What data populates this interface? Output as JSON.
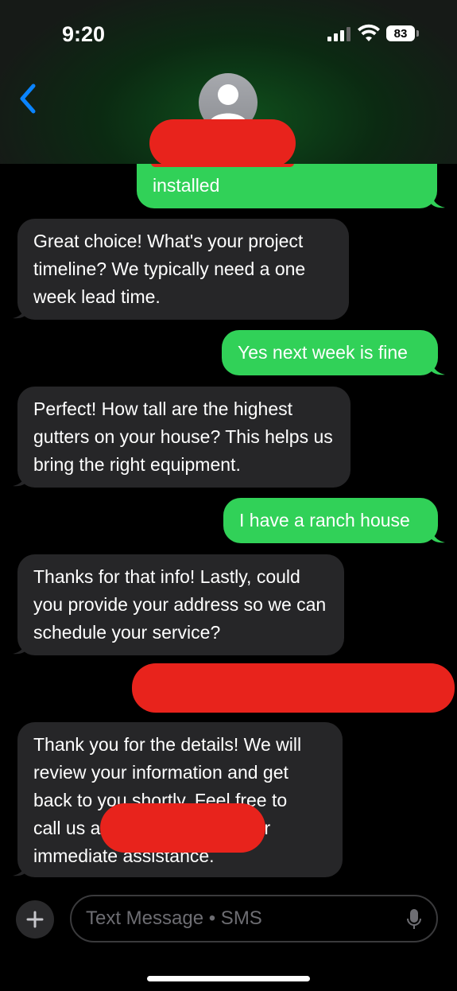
{
  "status": {
    "time": "9:20",
    "battery": "83"
  },
  "header": {
    "contact_name": ""
  },
  "messages": [
    {
      "from": "me",
      "text": "installed"
    },
    {
      "from": "them",
      "text": "Great choice! What's your project timeline? We typically need a one week lead time."
    },
    {
      "from": "me",
      "text": "Yes next week is fine"
    },
    {
      "from": "them",
      "text": "Perfect! How tall are the highest gutters on your house? This helps us bring the right equipment."
    },
    {
      "from": "me",
      "text": "I have a ranch house"
    },
    {
      "from": "them",
      "text": "Thanks for that info! Lastly, could you provide your address so we can schedule your service?"
    },
    {
      "from": "them",
      "line1": "Thank you for the details! We will",
      "line2": "review your information and get",
      "line3": "back to you shortly. Feel free to",
      "line4a": "call us a",
      "line4b": "for",
      "line5": "immediate assistance."
    }
  ],
  "input": {
    "placeholder": "Text Message • SMS"
  },
  "colors": {
    "outgoing": "#31d158",
    "incoming": "#262628",
    "accent": "#0a84ff",
    "redaction": "#e8231c"
  }
}
